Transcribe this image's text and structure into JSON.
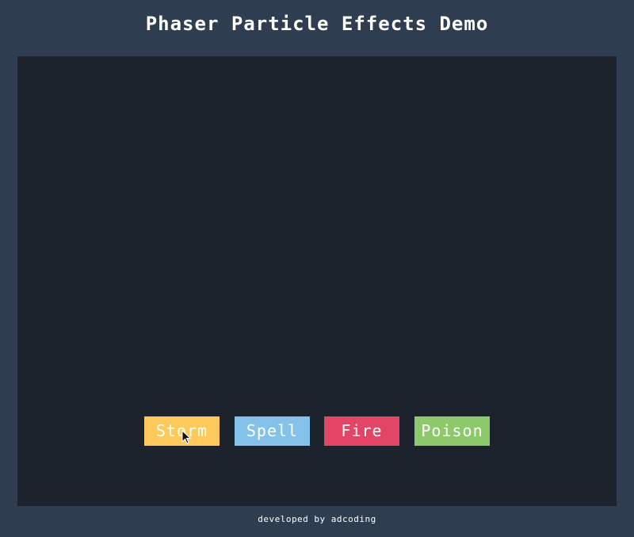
{
  "header": {
    "title": "Phaser Particle Effects Demo"
  },
  "canvas": {
    "background": "#1d232d"
  },
  "buttons": [
    {
      "label": "Storm",
      "color": "#fcc95a"
    },
    {
      "label": "Spell",
      "color": "#84c2ea"
    },
    {
      "label": "Fire",
      "color": "#e24566"
    },
    {
      "label": "Poison",
      "color": "#8dc86a"
    }
  ],
  "cursor": {
    "icon": "mouse-pointer-icon"
  },
  "footer": {
    "credit": "developed by adcoding"
  },
  "colors": {
    "page_background": "#2e3e50",
    "text": "#ffffff"
  }
}
